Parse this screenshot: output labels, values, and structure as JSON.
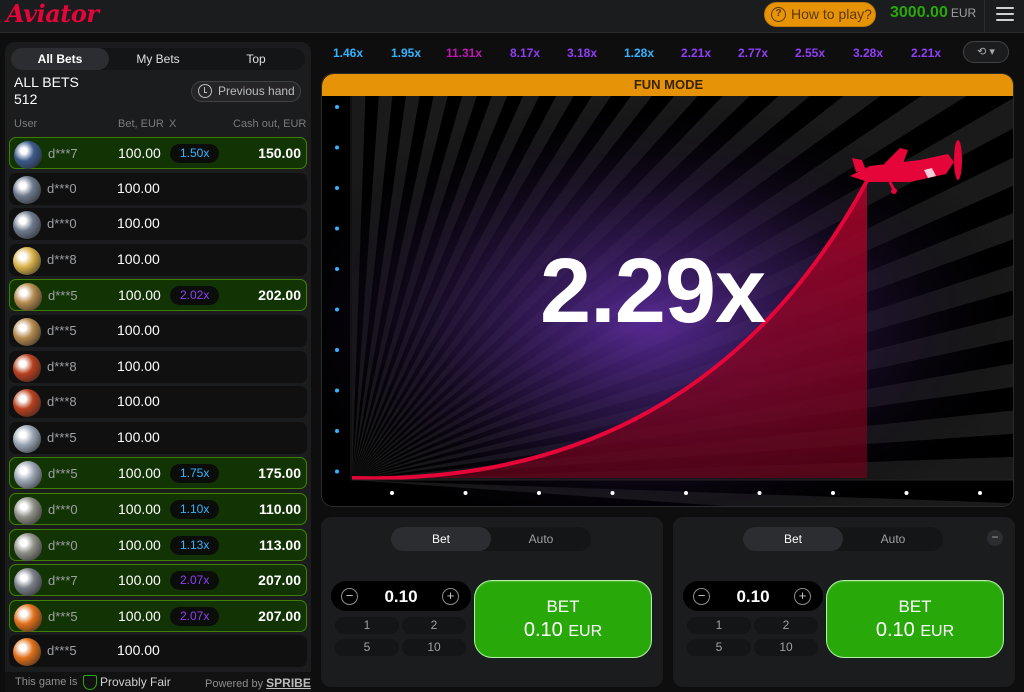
{
  "app": {
    "logo": "Aviator",
    "how_to_play": "How to play?",
    "balance": "3000.00",
    "currency": "EUR"
  },
  "left": {
    "tabs": [
      "All Bets",
      "My Bets",
      "Top"
    ],
    "all_bets_label": "ALL BETS",
    "all_bets_count": "512",
    "previous_hand": "Previous hand",
    "columns": {
      "user": "User",
      "bet": "Bet, EUR",
      "x": "X",
      "cashout": "Cash out, EUR"
    },
    "rows": [
      {
        "user": "d***7",
        "bet": "100.00",
        "mult": "1.50x",
        "cashout": "150.00",
        "win": true,
        "mult_color": "#34b4ff",
        "avatar": "#3b5a8a"
      },
      {
        "user": "d***0",
        "bet": "100.00",
        "mult": "",
        "cashout": "",
        "win": false,
        "mult_color": "",
        "avatar": "#6d7a8c"
      },
      {
        "user": "d***0",
        "bet": "100.00",
        "mult": "",
        "cashout": "",
        "win": false,
        "mult_color": "",
        "avatar": "#6d7a8c"
      },
      {
        "user": "d***8",
        "bet": "100.00",
        "mult": "",
        "cashout": "",
        "win": false,
        "mult_color": "",
        "avatar": "#d9b24a"
      },
      {
        "user": "d***5",
        "bet": "100.00",
        "mult": "2.02x",
        "cashout": "202.00",
        "win": true,
        "mult_color": "#913ef8",
        "avatar": "#b58a4e"
      },
      {
        "user": "d***5",
        "bet": "100.00",
        "mult": "",
        "cashout": "",
        "win": false,
        "mult_color": "",
        "avatar": "#b58a4e"
      },
      {
        "user": "d***8",
        "bet": "100.00",
        "mult": "",
        "cashout": "",
        "win": false,
        "mult_color": "",
        "avatar": "#b8401e"
      },
      {
        "user": "d***8",
        "bet": "100.00",
        "mult": "",
        "cashout": "",
        "win": false,
        "mult_color": "",
        "avatar": "#b8401e"
      },
      {
        "user": "d***5",
        "bet": "100.00",
        "mult": "",
        "cashout": "",
        "win": false,
        "mult_color": "",
        "avatar": "#9aa6b4"
      },
      {
        "user": "d***5",
        "bet": "100.00",
        "mult": "1.75x",
        "cashout": "175.00",
        "win": true,
        "mult_color": "#34b4ff",
        "avatar": "#9aa6b4"
      },
      {
        "user": "d***0",
        "bet": "100.00",
        "mult": "1.10x",
        "cashout": "110.00",
        "win": true,
        "mult_color": "#34b4ff",
        "avatar": "#8e8f86"
      },
      {
        "user": "d***0",
        "bet": "100.00",
        "mult": "1.13x",
        "cashout": "113.00",
        "win": true,
        "mult_color": "#34b4ff",
        "avatar": "#8e8f86"
      },
      {
        "user": "d***7",
        "bet": "100.00",
        "mult": "2.07x",
        "cashout": "207.00",
        "win": true,
        "mult_color": "#913ef8",
        "avatar": "#7a7f88"
      },
      {
        "user": "d***5",
        "bet": "100.00",
        "mult": "2.07x",
        "cashout": "207.00",
        "win": true,
        "mult_color": "#913ef8",
        "avatar": "#e0701a"
      },
      {
        "user": "d***5",
        "bet": "100.00",
        "mult": "",
        "cashout": "",
        "win": false,
        "mult_color": "",
        "avatar": "#e0701a"
      }
    ],
    "footer": {
      "this_game_is": "This game is",
      "provably_fair": "Provably Fair",
      "powered_by": "Powered by",
      "brand": "SPRIBE"
    }
  },
  "history": [
    {
      "v": "1.46x",
      "c": "#34b4ff"
    },
    {
      "v": "1.95x",
      "c": "#34b4ff"
    },
    {
      "v": "11.31x",
      "c": "#c017b4"
    },
    {
      "v": "8.17x",
      "c": "#913ef8"
    },
    {
      "v": "3.18x",
      "c": "#913ef8"
    },
    {
      "v": "1.28x",
      "c": "#34b4ff"
    },
    {
      "v": "2.21x",
      "c": "#913ef8"
    },
    {
      "v": "2.77x",
      "c": "#913ef8"
    },
    {
      "v": "2.55x",
      "c": "#913ef8"
    },
    {
      "v": "3.28x",
      "c": "#913ef8"
    },
    {
      "v": "2.21x",
      "c": "#913ef8"
    }
  ],
  "game": {
    "fun_mode": "FUN MODE",
    "multiplier": "2.29x",
    "accent": "#e50539"
  },
  "panels": [
    {
      "tabs": [
        "Bet",
        "Auto"
      ],
      "amount": "0.10",
      "quick": [
        "1",
        "2",
        "5",
        "10"
      ],
      "bet_label": "BET",
      "bet_amount": "0.10",
      "currency": "EUR",
      "minus": "−"
    },
    {
      "tabs": [
        "Bet",
        "Auto"
      ],
      "amount": "0.10",
      "quick": [
        "1",
        "2",
        "5",
        "10"
      ],
      "bet_label": "BET",
      "bet_amount": "0.10",
      "currency": "EUR",
      "minus": "−"
    }
  ]
}
